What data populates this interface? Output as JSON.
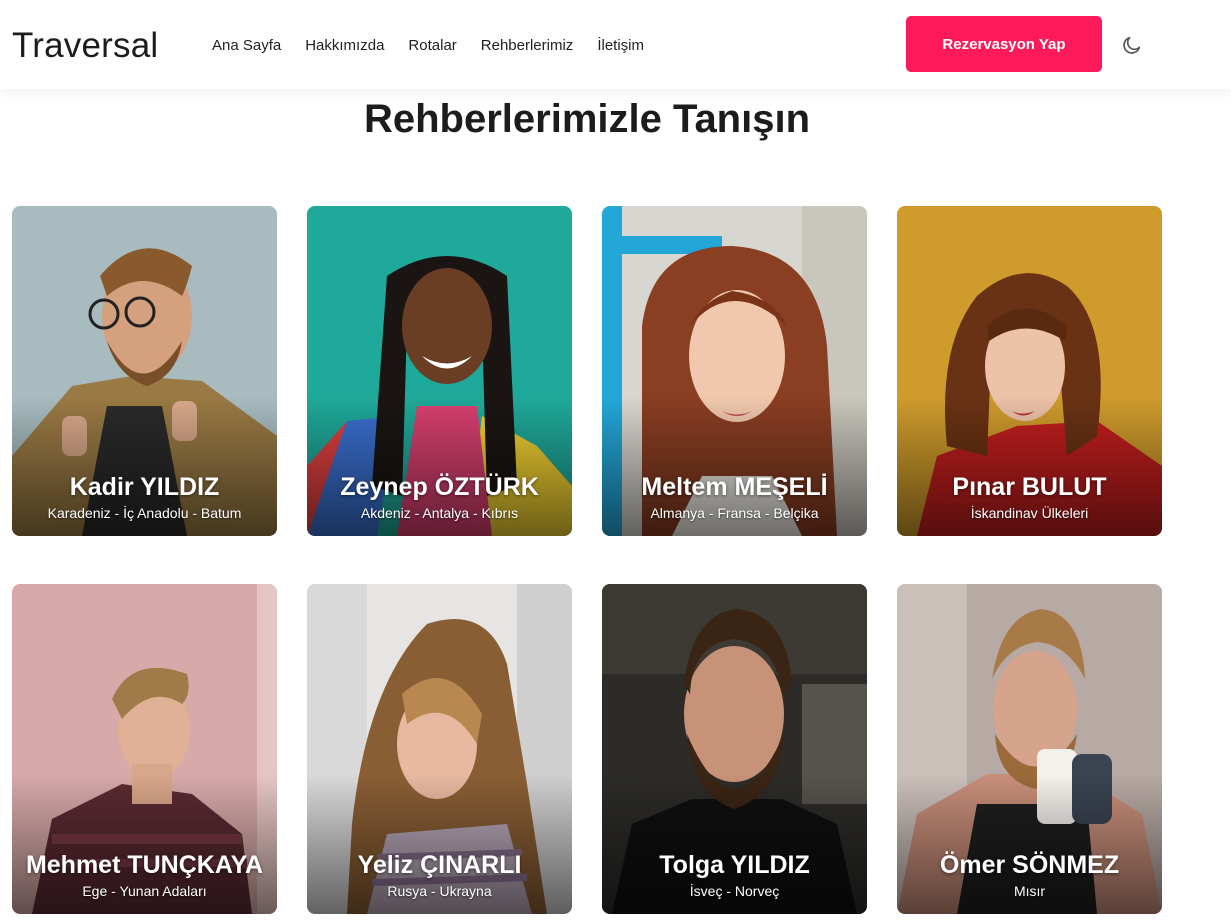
{
  "header": {
    "logo": "Traversal",
    "nav": [
      "Ana Sayfa",
      "Hakkımızda",
      "Rotalar",
      "Rehberlerimiz",
      "İletişim"
    ],
    "cta_label": "Rezervasyon Yap",
    "theme_icon": "moon-icon"
  },
  "section": {
    "title": "Rehberlerimizle Tanışın"
  },
  "guides": [
    {
      "name": "Kadir YILDIZ",
      "region": "Karadeniz - İç Anadolu - Batum"
    },
    {
      "name": "Zeynep ÖZTÜRK",
      "region": "Akdeniz - Antalya - Kıbrıs"
    },
    {
      "name": "Meltem MEŞELİ",
      "region": "Almanya - Fransa - Belçika"
    },
    {
      "name": "Pınar BULUT",
      "region": "İskandinav Ülkeleri"
    },
    {
      "name": "Mehmet TUNÇKAYA",
      "region": "Ege - Yunan Adaları"
    },
    {
      "name": "Yeliz ÇINARLI",
      "region": "Rusya - Ukrayna"
    },
    {
      "name": "Tolga YILDIZ",
      "region": "İsveç - Norveç"
    },
    {
      "name": "Ömer SÖNMEZ",
      "region": "Mısır"
    }
  ],
  "colors": {
    "accent": "#fe1a5a",
    "text": "#1c1c1c"
  }
}
